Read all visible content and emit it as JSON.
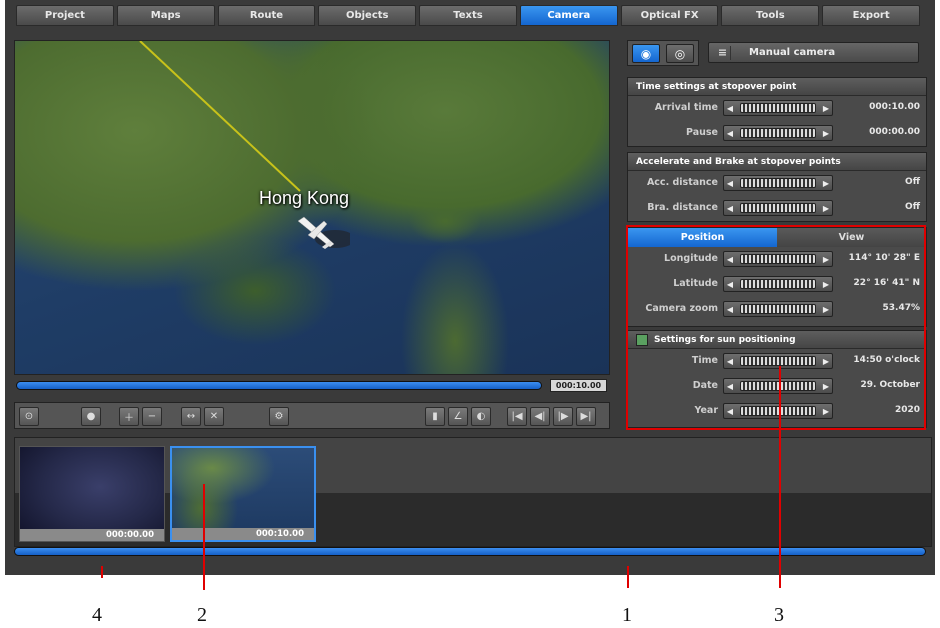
{
  "tabs": [
    "Project",
    "Maps",
    "Route",
    "Objects",
    "Texts",
    "Camera",
    "Optical FX",
    "Tools",
    "Export"
  ],
  "active_tab": "Camera",
  "map": {
    "label": "Hong Kong"
  },
  "playback": {
    "time": "000:10.00",
    "progress": 1.0
  },
  "camera_mode": {
    "label": "Manual camera",
    "icon": "list-icon"
  },
  "time_settings": {
    "title": "Time settings at stopover point",
    "rows": [
      {
        "label": "Arrival time",
        "value": "000:10.00"
      },
      {
        "label": "Pause",
        "value": "000:00.00"
      }
    ]
  },
  "accel": {
    "title": "Accelerate and Brake at stopover points",
    "rows": [
      {
        "label": "Acc. distance",
        "value": "Off"
      },
      {
        "label": "Bra. distance",
        "value": "Off"
      }
    ]
  },
  "position": {
    "tabs": [
      "Position",
      "View"
    ],
    "rows": [
      {
        "label": "Longitude",
        "value": "114° 10' 28\" E"
      },
      {
        "label": "Latitude",
        "value": "22° 16' 41\" N"
      },
      {
        "label": "Camera zoom",
        "value": "53.47%"
      }
    ]
  },
  "sun": {
    "title": "Settings for sun positioning",
    "rows": [
      {
        "label": "Time",
        "value": "14:50 o'clock"
      },
      {
        "label": "Date",
        "value": "29. October"
      },
      {
        "label": "Year",
        "value": "2020"
      }
    ]
  },
  "timeline": {
    "thumbs": [
      {
        "time": "000:00.00"
      },
      {
        "time": "000:10.00"
      }
    ]
  },
  "callouts": [
    "4",
    "2",
    "1",
    "3"
  ],
  "colors": {
    "accent": "#1e7ae0",
    "highlight": "#e00000"
  }
}
